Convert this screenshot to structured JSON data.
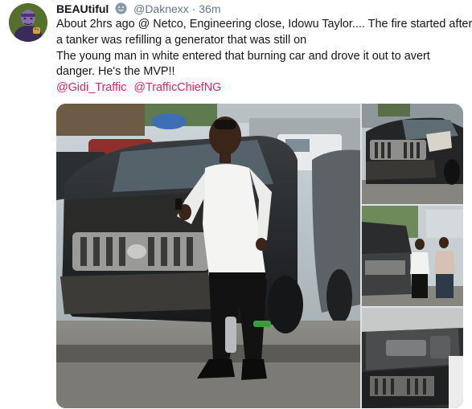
{
  "author": {
    "display_name": "BEAUtiful",
    "emoji_icon": "smiling-face-icon",
    "handle": "@Daknexx",
    "separator": "·",
    "time": "36m",
    "avatar_icon": "avatar-character-icon"
  },
  "tweet": {
    "lines": [
      "About 2hrs ago @ Netco, Engineering close, Idowu Taylor.... The fire started after",
      "a tanker was refilling a generator that was still on",
      "The young man in white entered that burning car and drove it out to avert",
      "danger. He's the MVP!!"
    ],
    "mentions": [
      "@Gidi_Traffic",
      "@TrafficChiefNG"
    ]
  },
  "colors": {
    "name_text": "#14171a",
    "secondary_text": "#657786",
    "mention": "#e0245e"
  },
  "media": {
    "photos": [
      "main-photo-man-by-burnt-suv",
      "photo-burnt-suv-front",
      "photo-two-men-by-open-hood",
      "photo-burnt-engine-bay"
    ]
  }
}
